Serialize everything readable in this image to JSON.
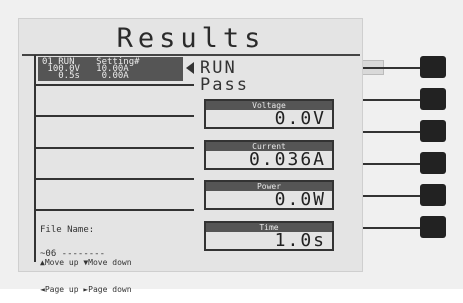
{
  "screen": {
    "title": "Results"
  },
  "selected_step": {
    "line1": "01 RUN    Setting#",
    "line2": " 100.0V   10.00A",
    "line3": "   0.5s    0.00A"
  },
  "file": {
    "label": "File Name:",
    "value": "~06 --------"
  },
  "nav": {
    "line1": "▲Move up ▼Move down",
    "line2": "◄Page up ►Page down"
  },
  "status": {
    "mode": "RUN",
    "result": "Pass"
  },
  "readings": [
    {
      "label": "Voltage",
      "value": "0.0V"
    },
    {
      "label": "Current",
      "value": "0.036A"
    },
    {
      "label": "Power",
      "value": "0.0W"
    },
    {
      "label": "Time",
      "value": "1.0s"
    }
  ]
}
